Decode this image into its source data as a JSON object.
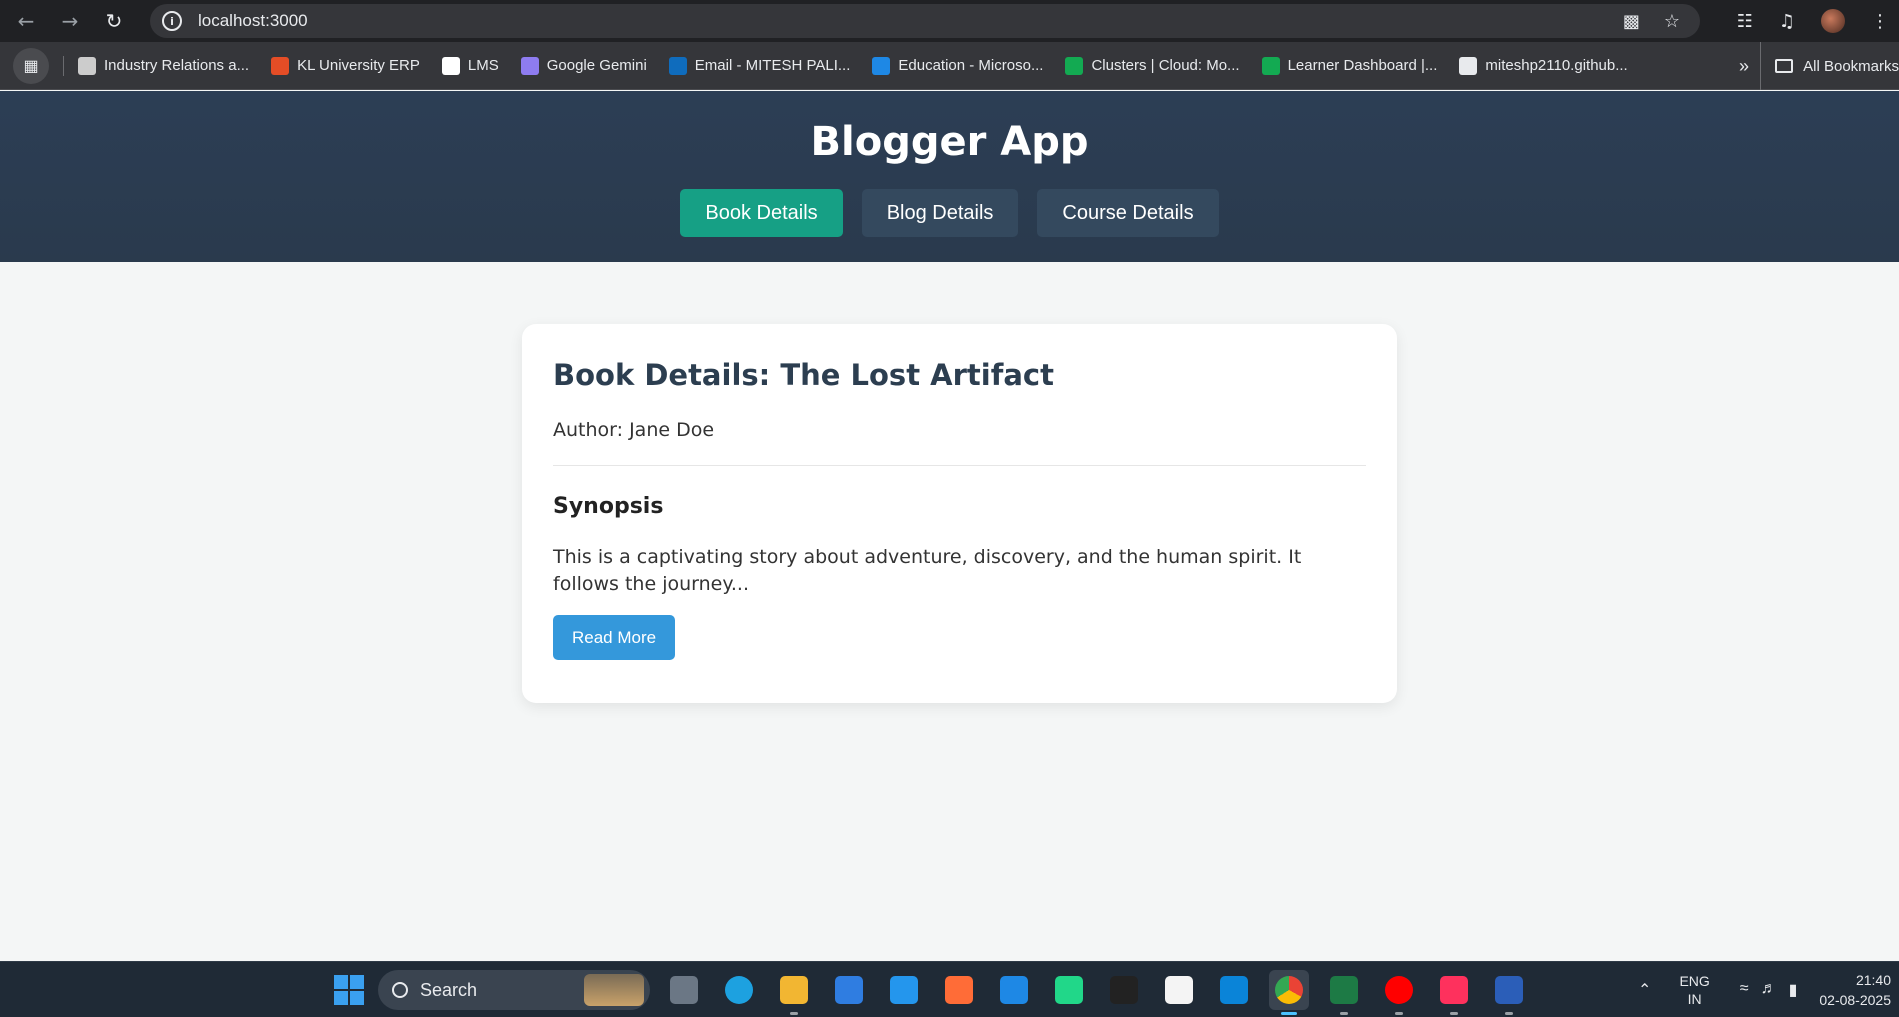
{
  "browser": {
    "url": "localhost:3000",
    "bookmarks": [
      {
        "label": "Industry Relations a...",
        "icon": "globe-icon",
        "color": "#cccccc"
      },
      {
        "label": "KL University ERP",
        "icon": "erp-icon",
        "color": "#e44d26"
      },
      {
        "label": "LMS",
        "icon": "moodle-icon",
        "color": "#ffffff"
      },
      {
        "label": "Google Gemini",
        "icon": "gemini-icon",
        "color": "#8e7cf0"
      },
      {
        "label": "Email - MITESH PALI...",
        "icon": "outlook-icon",
        "color": "#0f6cbd"
      },
      {
        "label": "Education - Microso...",
        "icon": "azure-icon",
        "color": "#1e88e5"
      },
      {
        "label": "Clusters | Cloud: Mo...",
        "icon": "mongodb-icon",
        "color": "#13aa52"
      },
      {
        "label": "Learner Dashboard |...",
        "icon": "mongodb-icon",
        "color": "#13aa52"
      },
      {
        "label": "miteshp2110.github...",
        "icon": "code-icon",
        "color": "#e8eaed"
      }
    ],
    "all_bookmarks_label": "All Bookmarks"
  },
  "app": {
    "title": "Blogger App",
    "tabs": [
      {
        "label": "Book Details",
        "active": true
      },
      {
        "label": "Blog Details",
        "active": false
      },
      {
        "label": "Course Details",
        "active": false
      }
    ],
    "accent_color": "#16a085",
    "header_color": "#2c3e55"
  },
  "card": {
    "title": "Book Details: The Lost Artifact",
    "author": "Author: Jane Doe",
    "synopsis_heading": "Synopsis",
    "synopsis_text": "This is a captivating story about adventure, discovery, and the human spirit. It follows the journey...",
    "button_label": "Read More",
    "button_color": "#3498db"
  },
  "taskbar": {
    "search_label": "Search",
    "apps": [
      "task-view-icon",
      "edge-icon",
      "file-explorer-icon",
      "app-store-icon",
      "docker-icon",
      "postman-icon",
      "webstorm-icon",
      "pycharm-icon",
      "notion-icon",
      "wix-icon",
      "vscode-icon",
      "chrome-icon",
      "excel-icon",
      "youtube-music-icon",
      "intellij-icon",
      "word-icon"
    ],
    "lang_top": "ENG",
    "lang_bottom": "IN",
    "time": "21:40",
    "date": "02-08-2025"
  }
}
